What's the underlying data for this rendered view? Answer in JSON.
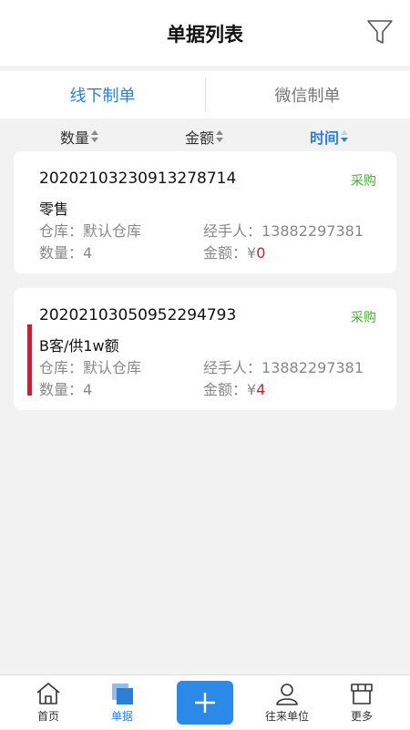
{
  "header": {
    "title": "单据列表"
  },
  "tabs": [
    {
      "label": "线下制单",
      "active": true
    },
    {
      "label": "微信制单",
      "active": false
    }
  ],
  "sort": [
    {
      "label": "数量",
      "active": false
    },
    {
      "label": "金额",
      "active": false
    },
    {
      "label": "时间",
      "active": true
    }
  ],
  "orders": [
    {
      "no": "20202103230913278714",
      "type": "采购",
      "name": "零售",
      "warehouse_label": "仓库：",
      "warehouse": "默认仓库",
      "handler_label": "经手人：",
      "handler": "13882297381",
      "qty_label": "数量：",
      "qty": "4",
      "amount_label": "金额：¥",
      "amount": "0"
    },
    {
      "no": "20202103050952294793",
      "type": "采购",
      "name": "B客/供1w额",
      "warehouse_label": "仓库：",
      "warehouse": "默认仓库",
      "handler_label": "经手人：",
      "handler": "13882297381",
      "qty_label": "数量：",
      "qty": "4",
      "amount_label": "金额：¥",
      "amount": "4"
    }
  ],
  "nav": [
    {
      "label": "首页",
      "icon": "home-icon",
      "active": false
    },
    {
      "label": "单据",
      "icon": "documents-icon",
      "active": true
    },
    {
      "label": "",
      "icon": "plus-icon",
      "active": false
    },
    {
      "label": "往来单位",
      "icon": "contacts-icon",
      "active": false
    },
    {
      "label": "更多",
      "icon": "store-icon",
      "active": false
    }
  ],
  "colors": {
    "accent": "#2b7fd8",
    "purchase_tag": "#4caa3c",
    "amount": "#c0242e",
    "flag": "#c0242e"
  }
}
